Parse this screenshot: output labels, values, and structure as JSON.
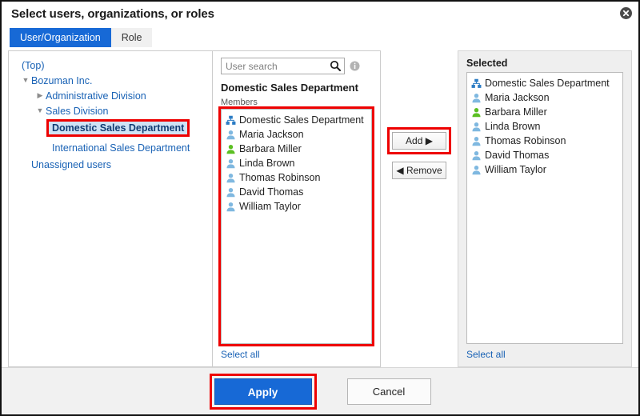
{
  "dialog": {
    "title": "Select users, organizations, or roles",
    "close_icon": "close-circle-icon"
  },
  "tabs": [
    {
      "label": "User/Organization",
      "active": true
    },
    {
      "label": "Role",
      "active": false
    }
  ],
  "tree": {
    "top_label": "(Top)",
    "nodes": [
      {
        "label": "Bozuman Inc.",
        "depth": 0,
        "marker": "▼",
        "state": "expanded"
      },
      {
        "label": "Administrative Division",
        "depth": 1,
        "marker": "▶",
        "state": "collapsed"
      },
      {
        "label": "Sales Division",
        "depth": 1,
        "marker": "▼",
        "state": "expanded"
      },
      {
        "label": "Domestic Sales Department",
        "depth": 2,
        "marker": "",
        "state": "selected"
      },
      {
        "label": "International Sales Department",
        "depth": 2,
        "marker": "",
        "state": "normal"
      },
      {
        "label": "Unassigned users",
        "depth": 0,
        "marker": "",
        "state": "normal"
      }
    ]
  },
  "middle": {
    "search": {
      "placeholder": "User search",
      "value": "",
      "search_icon": "search-icon",
      "info_icon": "info-icon"
    },
    "heading": "Domestic Sales Department",
    "members_label": "Members",
    "items": [
      {
        "label": "Domestic Sales Department",
        "icon": "organization-icon",
        "color": "#2b7cc4"
      },
      {
        "label": "Maria Jackson",
        "icon": "user-icon",
        "color": "#7fb8e0"
      },
      {
        "label": "Barbara Miller",
        "icon": "user-icon",
        "color": "#5bbf22"
      },
      {
        "label": "Linda Brown",
        "icon": "user-icon",
        "color": "#7fb8e0"
      },
      {
        "label": "Thomas Robinson",
        "icon": "user-icon",
        "color": "#7fb8e0"
      },
      {
        "label": "David Thomas",
        "icon": "user-icon",
        "color": "#7fb8e0"
      },
      {
        "label": "William Taylor",
        "icon": "user-icon",
        "color": "#7fb8e0"
      }
    ],
    "select_all": "Select all"
  },
  "transfer": {
    "add_label": "Add ▶",
    "remove_label": "◀ Remove"
  },
  "selected": {
    "heading": "Selected",
    "items": [
      {
        "label": "Domestic Sales Department",
        "icon": "organization-icon",
        "color": "#2b7cc4"
      },
      {
        "label": "Maria Jackson",
        "icon": "user-icon",
        "color": "#7fb8e0"
      },
      {
        "label": "Barbara Miller",
        "icon": "user-icon",
        "color": "#5bbf22"
      },
      {
        "label": "Linda Brown",
        "icon": "user-icon",
        "color": "#7fb8e0"
      },
      {
        "label": "Thomas Robinson",
        "icon": "user-icon",
        "color": "#7fb8e0"
      },
      {
        "label": "David Thomas",
        "icon": "user-icon",
        "color": "#7fb8e0"
      },
      {
        "label": "William Taylor",
        "icon": "user-icon",
        "color": "#7fb8e0"
      }
    ],
    "select_all": "Select all"
  },
  "footer": {
    "apply_label": "Apply",
    "cancel_label": "Cancel"
  },
  "colors": {
    "accent": "#1769d6",
    "annotation": "#ee0000",
    "link": "#1962b5",
    "tree_selected_bg": "#cfe3f5"
  }
}
